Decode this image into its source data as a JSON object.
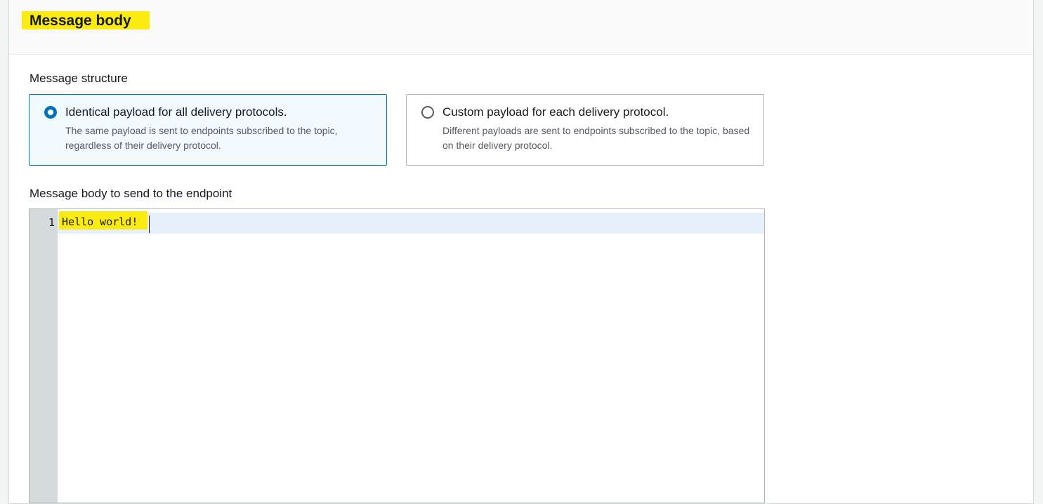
{
  "panel": {
    "title": "Message body"
  },
  "message_structure": {
    "label": "Message structure",
    "options": [
      {
        "title": "Identical payload for all delivery protocols.",
        "description": "The same payload is sent to endpoints subscribed to the topic, regardless of their delivery protocol.",
        "selected": true
      },
      {
        "title": "Custom payload for each delivery protocol.",
        "description": "Different payloads are sent to endpoints subscribed to the topic, based on their delivery protocol.",
        "selected": false
      }
    ]
  },
  "editor": {
    "label": "Message body to send to the endpoint",
    "lines": [
      {
        "number": "1",
        "text": "Hello world!"
      }
    ]
  },
  "colors": {
    "highlight": "#fbeb0f",
    "accent": "#0073bb",
    "selected_background": "#f1faff",
    "active_line": "#e6f0fc",
    "gutter": "#d5dbdb"
  }
}
